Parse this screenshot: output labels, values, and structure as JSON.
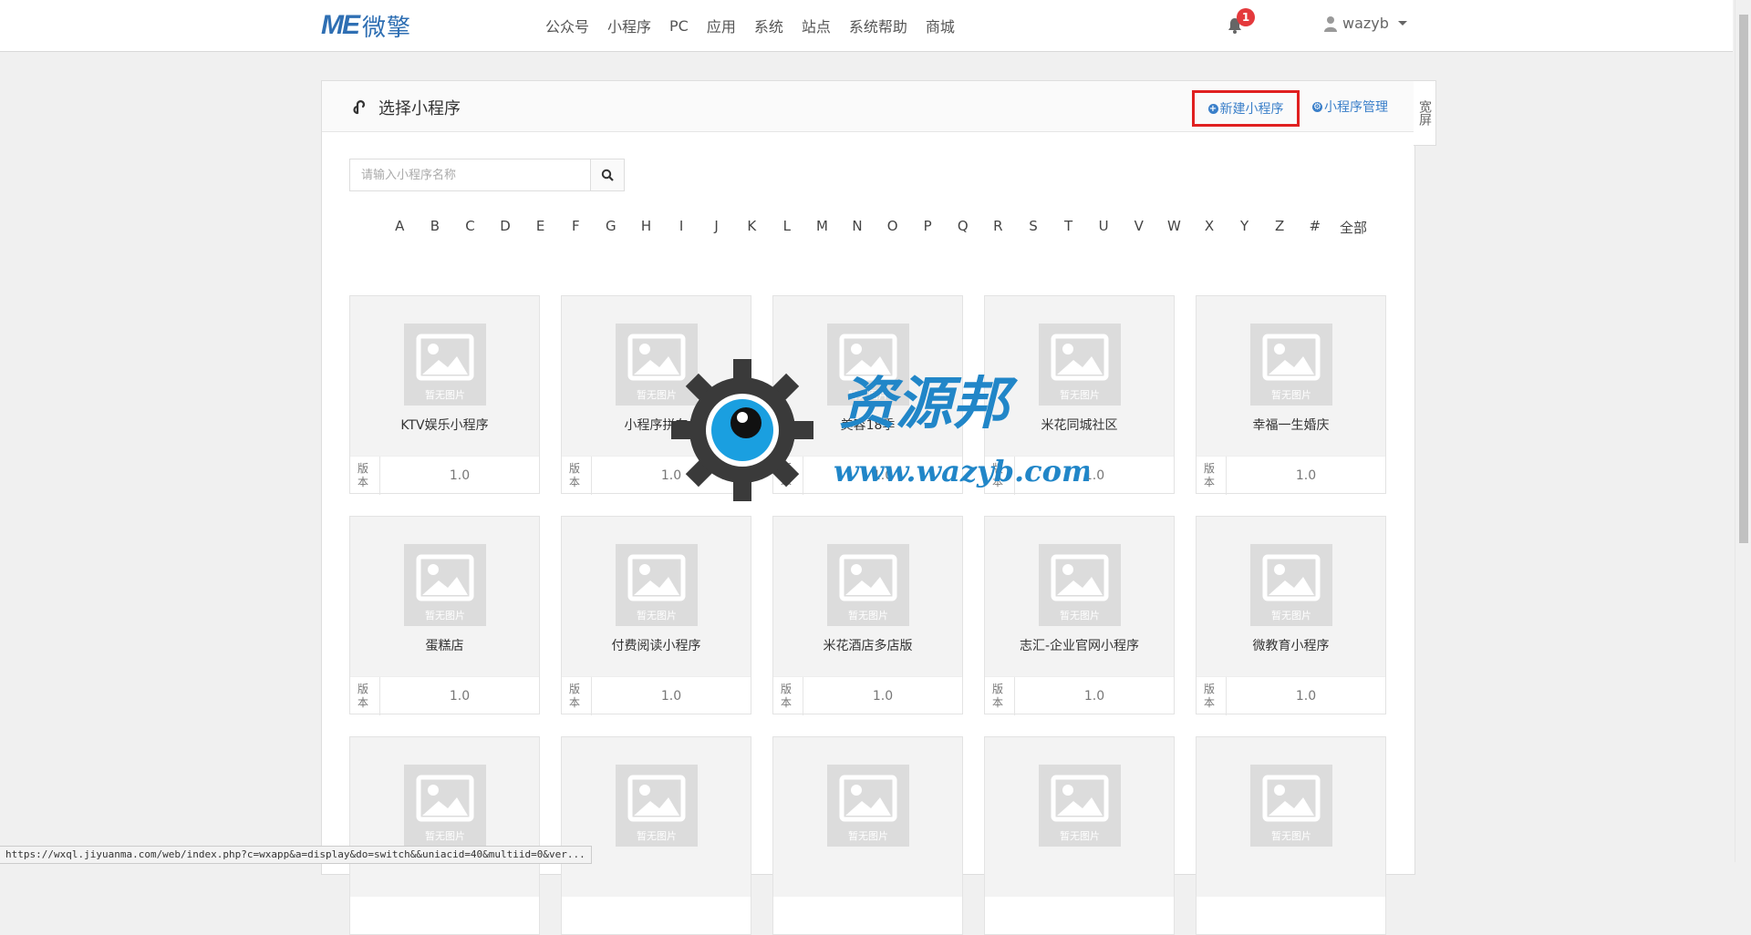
{
  "header": {
    "logo_mark": "ME",
    "logo_text": "微擎",
    "nav": [
      "公众号",
      "小程序",
      "PC",
      "应用",
      "系统",
      "站点",
      "系统帮助",
      "商城"
    ],
    "notification_count": "1",
    "username": "wazyb"
  },
  "panel": {
    "title": "选择小程序",
    "new_button": "新建小程序",
    "manage_button": "小程序管理",
    "wide_toggle": "宽屏",
    "search_placeholder": "请输入小程序名称",
    "letters": [
      "A",
      "B",
      "C",
      "D",
      "E",
      "F",
      "G",
      "H",
      "I",
      "J",
      "K",
      "L",
      "M",
      "N",
      "O",
      "P",
      "Q",
      "R",
      "S",
      "T",
      "U",
      "V",
      "W",
      "X",
      "Y",
      "Z",
      "#",
      "全部"
    ]
  },
  "cards": [
    {
      "name": "KTV娱乐小程序",
      "no_image": "暂无图片",
      "version_label": "版本",
      "version": "1.0"
    },
    {
      "name": "小程序拼车",
      "no_image": "暂无图片",
      "version_label": "版本",
      "version": "1.0"
    },
    {
      "name": "美容18季",
      "no_image": "暂无图片",
      "version_label": "版本",
      "version": "1.0"
    },
    {
      "name": "米花同城社区",
      "no_image": "暂无图片",
      "version_label": "版本",
      "version": "1.0"
    },
    {
      "name": "幸福一生婚庆",
      "no_image": "暂无图片",
      "version_label": "版本",
      "version": "1.0"
    },
    {
      "name": "蛋糕店",
      "no_image": "暂无图片",
      "version_label": "版本",
      "version": "1.0"
    },
    {
      "name": "付费阅读小程序",
      "no_image": "暂无图片",
      "version_label": "版本",
      "version": "1.0"
    },
    {
      "name": "米花酒店多店版",
      "no_image": "暂无图片",
      "version_label": "版本",
      "version": "1.0"
    },
    {
      "name": "志汇-企业官网小程序",
      "no_image": "暂无图片",
      "version_label": "版本",
      "version": "1.0"
    },
    {
      "name": "微教育小程序",
      "no_image": "暂无图片",
      "version_label": "版本",
      "version": "1.0"
    },
    {
      "name": "",
      "no_image": "暂无图片"
    },
    {
      "name": "",
      "no_image": "暂无图片"
    },
    {
      "name": "",
      "no_image": "暂无图片"
    },
    {
      "name": "",
      "no_image": "暂无图片"
    },
    {
      "name": "",
      "no_image": "暂无图片"
    }
  ],
  "watermark": {
    "title": "资源邦",
    "url": "www.wazyb.com"
  },
  "status_url": "https://wxql.jiyuanma.com/web/index.php?c=wxapp&a=display&do=switch&&uniacid=40&multiid=0&ver...",
  "colors": {
    "brand": "#2f6fb3",
    "link": "#3a7fc9",
    "highlight": "#e02020",
    "badge": "#e4393c"
  }
}
